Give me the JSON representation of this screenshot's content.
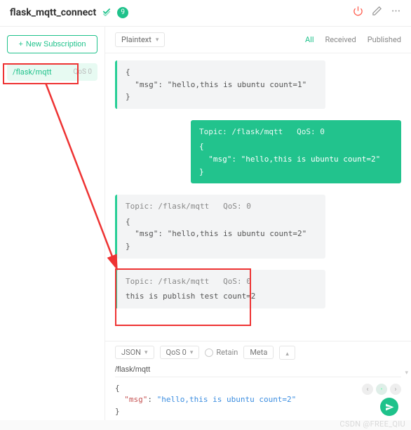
{
  "titlebar": {
    "name": "flask_mqtt_connect",
    "badge": "9"
  },
  "sidebar": {
    "new_sub_label": "New Subscription",
    "subscriptions": [
      {
        "topic": "/flask/mqtt",
        "qos": "QoS 0"
      }
    ]
  },
  "toolbar": {
    "format": "Plaintext",
    "filters": {
      "all": "All",
      "received": "Received",
      "published": "Published"
    }
  },
  "messages": [
    {
      "side": "left",
      "topic": "",
      "qos": "",
      "body": "{\n  \"msg\": \"hello,this is ubuntu count=1\"\n}"
    },
    {
      "side": "right",
      "topic": "Topic: /flask/mqtt",
      "qos": "QoS: 0",
      "body": "{\n  \"msg\": \"hello,this is ubuntu count=2\"\n}"
    },
    {
      "side": "left",
      "topic": "Topic: /flask/mqtt",
      "qos": "QoS: 0",
      "body": "{\n  \"msg\": \"hello,this is ubuntu count=2\"\n}"
    },
    {
      "side": "left",
      "topic": "Topic: /flask/mqtt",
      "qos": "QoS: 0",
      "body": "this is publish test count=2"
    }
  ],
  "publish": {
    "payload_dd": "JSON",
    "qos_dd": "QoS 0",
    "retain": "Retain",
    "meta": "Meta",
    "topic": "/flask/mqtt",
    "payload_key": "\"msg\"",
    "payload_val": "\"hello,this is ubuntu count=2\""
  },
  "watermark": "CSDN @FREE_QIU"
}
